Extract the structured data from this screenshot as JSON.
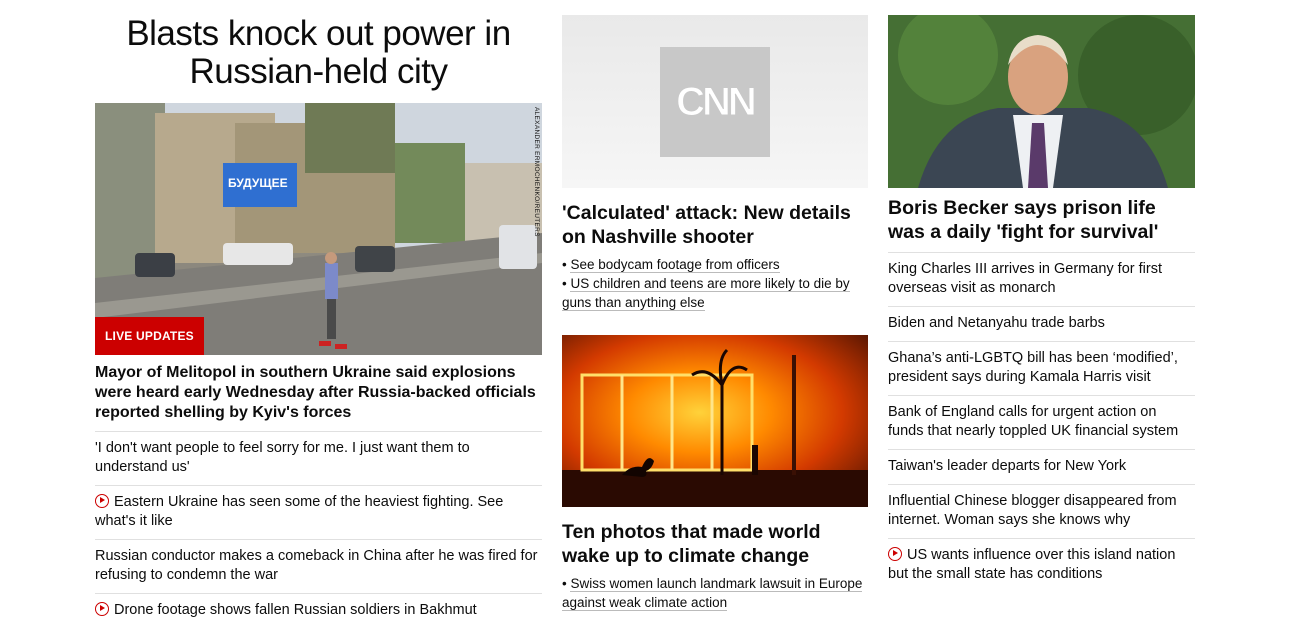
{
  "left": {
    "title": "Blasts knock out power in Russian-held city",
    "image_credit": "ALEXANDER ERMOCHENKO/REUTERS",
    "billboard_text": "БУДУЩЕЕ",
    "badge": "LIVE UPDATES",
    "headline": "Mayor of Melitopol in southern Ukraine said explosions were heard early Wednesday after Russia-backed officials reported shelling by Kyiv's forces",
    "stories": [
      {
        "text": "'I don't want people to feel sorry for me. I just want them to understand us'",
        "video": false
      },
      {
        "text": "Eastern Ukraine has seen some of the heaviest fighting. See what's it like",
        "video": true
      },
      {
        "text": "Russian conductor makes a comeback in China after he was fired for refusing to condemn the war",
        "video": false
      },
      {
        "text": "Drone footage shows fallen Russian soldiers in Bakhmut",
        "video": true
      }
    ]
  },
  "middle": {
    "card1": {
      "logo": "CNN",
      "headline": "'Calculated' attack: New details on Nashville shooter",
      "bullets": [
        "See bodycam footage from officers",
        "US children and teens are more likely to die by guns than anything else"
      ]
    },
    "card2": {
      "headline": "Ten photos that made world wake up to climate change",
      "bullets": [
        "Swiss women launch landmark lawsuit in Europe against weak climate action"
      ]
    }
  },
  "right": {
    "headline": "Boris Becker says prison life was a daily 'fight for survival'",
    "stories": [
      {
        "text": "King Charles III arrives in Germany for first overseas visit as monarch",
        "video": false
      },
      {
        "text": "Biden and Netanyahu trade barbs",
        "video": false
      },
      {
        "text": "Ghana’s anti-LGBTQ bill has been ‘modified’, president says during Kamala Harris visit",
        "video": false
      },
      {
        "text": "Bank of England calls for urgent action on funds that nearly toppled UK financial system",
        "video": false
      },
      {
        "text": "Taiwan's leader departs for New York",
        "video": false
      },
      {
        "text": "Influential Chinese blogger disappeared from internet. Woman says she knows why",
        "video": false
      },
      {
        "text": "US wants influence over this island nation but the small state has conditions",
        "video": true
      }
    ]
  },
  "colors": {
    "accent": "#cc0000",
    "divider": "#e0e0e0"
  }
}
